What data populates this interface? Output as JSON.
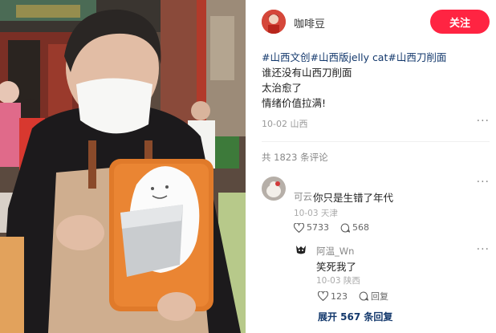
{
  "post": {
    "author": "咖啡豆",
    "follow_label": "关注",
    "tags": [
      "#山西文创",
      "#山西版jelly cat",
      "#山西刀削面"
    ],
    "lines": [
      "谁还没有山西刀削面",
      "太治愈了",
      "情绪价值拉满!"
    ],
    "date": "10-02",
    "location": "山西",
    "more_icon": "ellipsis-icon"
  },
  "comments": {
    "count_text": "共 1823 条评论",
    "items": [
      {
        "name": "可云",
        "text": "你只是生错了年代",
        "date": "10-03",
        "location": "天津",
        "likes": "5733",
        "replies": "568"
      }
    ],
    "reply": {
      "name": "阿温_Wn",
      "text": "笑死我了",
      "date": "10-03",
      "location": "陕西",
      "likes": "123",
      "reply_label": "回复"
    },
    "expand_label": "展开 567 条回复"
  },
  "colors": {
    "accent": "#ff2442",
    "tag": "#13386c",
    "muted": "#999999"
  }
}
